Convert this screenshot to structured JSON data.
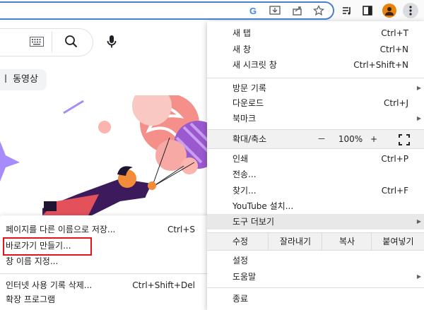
{
  "toolbar": {
    "icons": [
      "google-icon",
      "download-icon",
      "share-icon",
      "bookmark-star-icon",
      "reading-list-icon",
      "side-panel-icon",
      "profile-icon",
      "more-icon"
    ]
  },
  "page": {
    "chip_text": "ㅣ 동영상"
  },
  "main_menu": {
    "new_tab": {
      "label": "새 탭",
      "shortcut": "Ctrl+T"
    },
    "new_window": {
      "label": "새 창",
      "shortcut": "Ctrl+N"
    },
    "incognito": {
      "label": "새 시크릿 창",
      "shortcut": "Ctrl+Shift+N"
    },
    "history": {
      "label": "방문 기록"
    },
    "downloads": {
      "label": "다운로드",
      "shortcut": "Ctrl+J"
    },
    "bookmarks": {
      "label": "북마크"
    },
    "zoom": {
      "label": "확대/축소",
      "minus": "－",
      "value": "100%",
      "plus": "+"
    },
    "print": {
      "label": "인쇄",
      "shortcut": "Ctrl+P"
    },
    "cast": {
      "label": "전송..."
    },
    "find": {
      "label": "찾기...",
      "shortcut": "Ctrl+F"
    },
    "install": {
      "label": "YouTube 설치..."
    },
    "more_tools": {
      "label": "도구 더보기"
    },
    "edit": {
      "label": "수정",
      "cut": "잘라내기",
      "copy": "복사",
      "paste": "붙여넣기"
    },
    "settings": {
      "label": "설정"
    },
    "help": {
      "label": "도움말"
    },
    "exit": {
      "label": "종료"
    }
  },
  "submenu": {
    "save_page": {
      "label": "페이지를 다른 이름으로 저장...",
      "shortcut": "Ctrl+S"
    },
    "create_shortcut": {
      "label": "바로가기 만들기..."
    },
    "name_window": {
      "label": "창 이름 지정..."
    },
    "clear_data": {
      "label": "인터넷 사용 기록 삭제...",
      "shortcut": "Ctrl+Shift+Del"
    },
    "extensions": {
      "label": "확장 프로그램"
    }
  },
  "colors": {
    "highlight": "#e3131b",
    "accent": "#4a7fd6"
  }
}
